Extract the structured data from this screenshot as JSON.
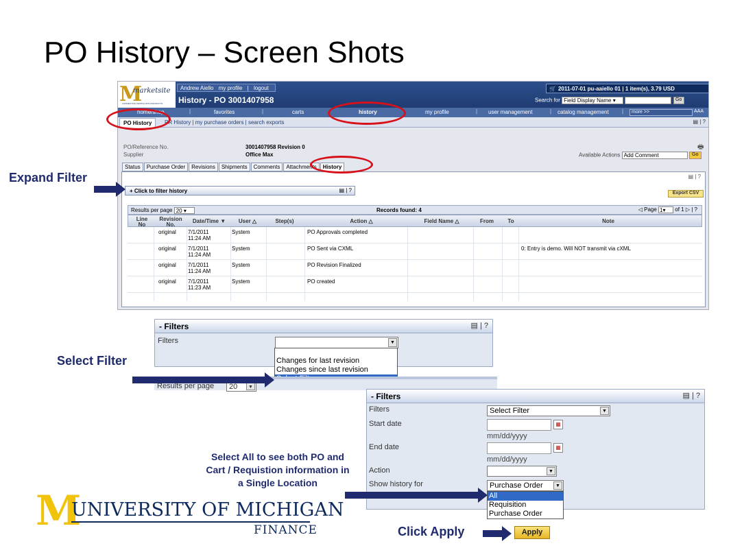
{
  "slide_title": "PO History – Screen Shots",
  "app": {
    "logo_letter": "M",
    "logo_word": "marketsite",
    "logo_tagline": "CONNECTING PEOPLE WITH PRODUCTS",
    "user_links": [
      "Andrew Aiello",
      "my profile",
      "|",
      "logout"
    ],
    "page_title": "History - PO 3001407958",
    "cart_summary": "2011-07-01 pu-aaiello 01 | 1 item(s), 3.79 USD",
    "search_label": "Search for",
    "search_select": "Field Display Name",
    "search_go": "Go",
    "nav": [
      "home/shop",
      "favorites",
      "carts",
      "history",
      "my profile",
      "user management",
      "catalog management"
    ],
    "nav_more": "more >>",
    "nav_font": "AAA",
    "subnav_active": "PO History",
    "subnav_rest": "PR History  |  my purchase orders  |  search exports",
    "po_labels": [
      "PO/Reference No.",
      "Supplier"
    ],
    "po_values": [
      "3001407958 Revision 0",
      "Office Max"
    ],
    "available_actions_label": "Available Actions",
    "available_actions_value": "Add Comment",
    "actions_go": "Go",
    "tabs": [
      "Status",
      "Purchase Order",
      "Revisions",
      "Shipments",
      "Comments",
      "Attachments",
      "History"
    ],
    "filter_toggle": "+ Click to filter history",
    "export_csv": "Export CSV",
    "results_per_page_label": "Results per page",
    "results_per_page_value": "20",
    "records_found": "Records found: 4",
    "page_label": "Page",
    "page_value": "1",
    "page_of": "of 1",
    "columns": [
      "Line No",
      "Revision No.",
      "Date/Time",
      "User",
      "Step(s)",
      "Action",
      "Field Name",
      "From",
      "To",
      "Note"
    ],
    "rows": [
      {
        "revision": "original",
        "date": "7/1/2011",
        "time": "11:24 AM",
        "user": "System",
        "action": "PO Approvals completed",
        "note": ""
      },
      {
        "revision": "original",
        "date": "7/1/2011",
        "time": "11:24 AM",
        "user": "System",
        "action": "PO Sent via CXML",
        "note": "0: Entry is demo. Will NOT transmit via cXML"
      },
      {
        "revision": "original",
        "date": "7/1/2011",
        "time": "11:24 AM",
        "user": "System",
        "action": "PO Revision Finalized",
        "note": ""
      },
      {
        "revision": "original",
        "date": "7/1/2011",
        "time": "11:23 AM",
        "user": "System",
        "action": "PO created",
        "note": ""
      }
    ]
  },
  "filters1": {
    "header": "- Filters",
    "filters_label": "Filters",
    "options": [
      "Changes for last revision",
      "Changes since last revision",
      "Select Filter"
    ],
    "results_per_page_label": "Results per page",
    "results_per_page_value": "20"
  },
  "filters2": {
    "header": "- Filters",
    "filters_label": "Filters",
    "filters_value": "Select Filter",
    "start_date_label": "Start date",
    "start_date_hint": "mm/dd/yyyy",
    "end_date_label": "End date",
    "end_date_hint": "mm/dd/yyyy",
    "action_label": "Action",
    "show_history_label": "Show history for",
    "show_history_value": "Purchase Order",
    "show_history_options": [
      "All",
      "Requisition",
      "Purchase Order"
    ]
  },
  "annotations": {
    "expand_filter": "Expand Filter",
    "select_filter": "Select Filter",
    "select_all_line1": "Select All to see both PO and",
    "select_all_line2": "Cart / Requistion information in",
    "select_all_line3": "a Single Location",
    "click_apply": "Click Apply",
    "apply_button": "Apply"
  },
  "footer_logo": {
    "letter": "M",
    "name": "UNIVERSITY OF MICHIGAN",
    "unit": "FINANCE"
  },
  "colors": {
    "annotation": "#1f2b6e",
    "highlight_ellipse": "#d7101a",
    "header_blue": "#1f3c72",
    "michigan_maize": "#f2c30b"
  }
}
